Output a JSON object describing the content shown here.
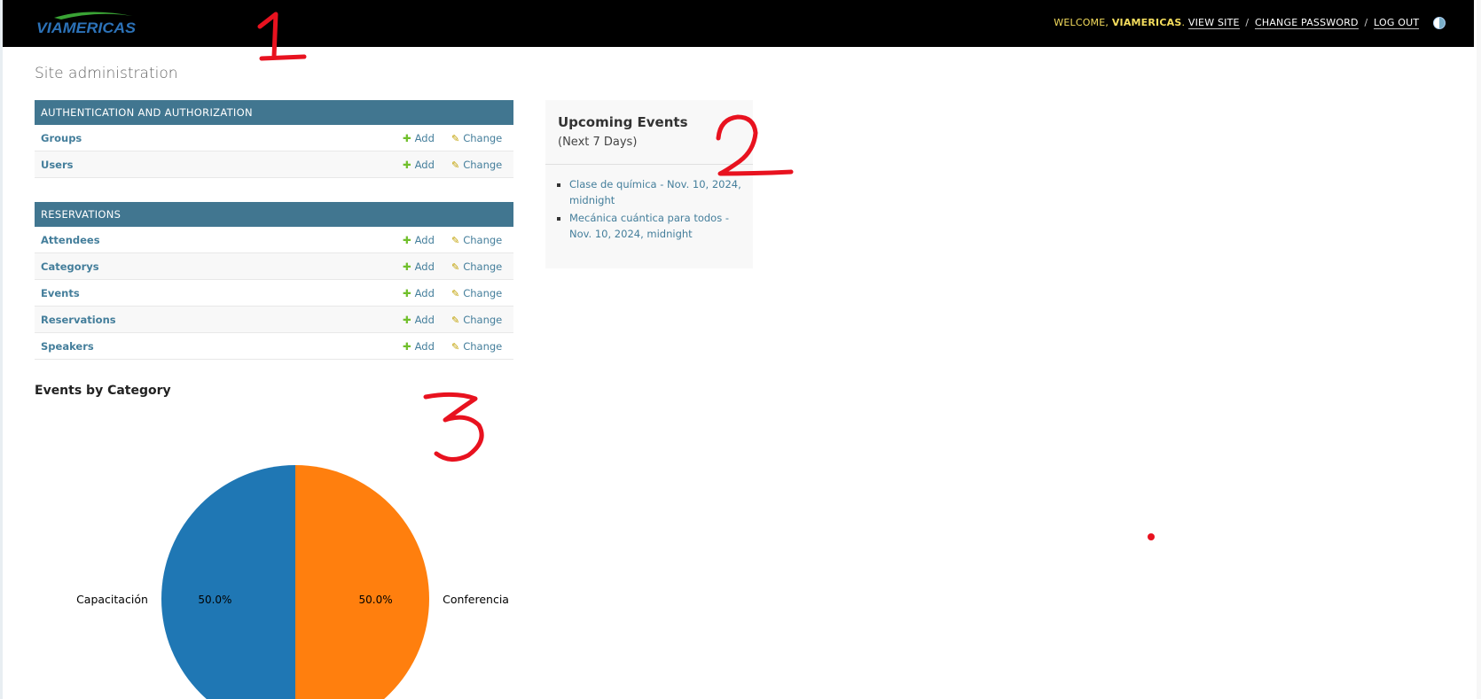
{
  "header": {
    "brand": "VIAMERICAS",
    "welcome_label": "WELCOME,",
    "username": "VIAMERICAS",
    "view_site": "VIEW SITE",
    "change_password": "CHANGE PASSWORD",
    "log_out": "LOG OUT",
    "separator": "/",
    "theme_icon": "theme-toggle-icon"
  },
  "page_title": "Site administration",
  "modules": [
    {
      "caption": "AUTHENTICATION AND AUTHORIZATION",
      "rows": [
        {
          "name": "Groups",
          "add": "Add",
          "change": "Change"
        },
        {
          "name": "Users",
          "add": "Add",
          "change": "Change"
        }
      ]
    },
    {
      "caption": "RESERVATIONS",
      "rows": [
        {
          "name": "Attendees",
          "add": "Add",
          "change": "Change"
        },
        {
          "name": "Categorys",
          "add": "Add",
          "change": "Change"
        },
        {
          "name": "Events",
          "add": "Add",
          "change": "Change"
        },
        {
          "name": "Reservations",
          "add": "Add",
          "change": "Change"
        },
        {
          "name": "Speakers",
          "add": "Add",
          "change": "Change"
        }
      ]
    }
  ],
  "upcoming": {
    "title": "Upcoming Events",
    "subtitle": "(Next 7 Days)",
    "items": [
      "Clase de química - Nov. 10, 2024, midnight",
      "Mecánica cuántica para todos - Nov. 10, 2024, midnight"
    ]
  },
  "chart_data": {
    "type": "pie",
    "title": "Events by Category",
    "categories": [
      "Capacitación",
      "Conferencia"
    ],
    "values": [
      50.0,
      50.0
    ],
    "value_labels": [
      "50.0%",
      "50.0%"
    ],
    "colors": [
      "#1f77b4",
      "#ff7f0e"
    ]
  },
  "annotations": [
    "1",
    "2",
    "3"
  ],
  "colors": {
    "header_bg": "#000000",
    "module_caption_bg": "#417690",
    "link": "#447e9b",
    "add_icon": "#70bf2b",
    "annotation": "#e8121f"
  }
}
